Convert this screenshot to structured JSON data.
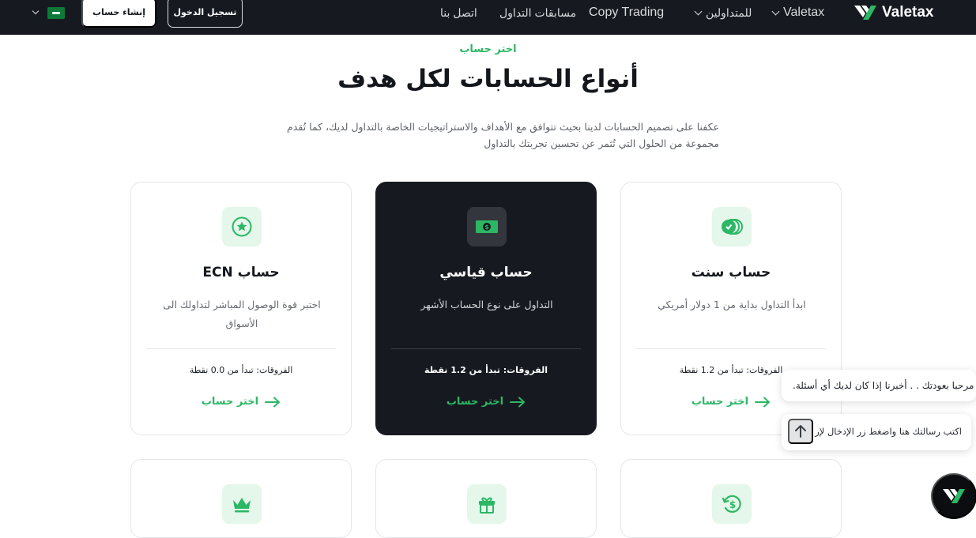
{
  "nav": {
    "brand": "Valetax",
    "items": {
      "valetax": "Valetax",
      "traders": "للمتداولين",
      "copy_trading": "Copy Trading",
      "competitions": "مسابقات التداول",
      "contact": "اتصل بنا"
    },
    "login_label": "تسجيل الدخول",
    "register_label": "إنشاء حساب",
    "language_flag": "saudi-arabia-flag"
  },
  "hero": {
    "eyebrow": "اختر حساب",
    "title": "أنواع الحسابات لكل هدف",
    "description": "عكفنا على تصميم الحسابات لدينا بحيث تتوافق مع الأهداف والاستراتيجيات الخاصة بالتداول لديك، كما تُقدم مجموعة من الحلول التي تُثمر عن تحسين تجربتك بالتداول"
  },
  "accounts": [
    {
      "title": "حساب سنت",
      "subtitle": "ابدأ التداول بداية من 1 دولار أمريكي",
      "spread": "الفروقات: تبدأ من 1.2 نقطة",
      "cta": "اختر حساب",
      "icon": "coins-icon",
      "highlighted": false
    },
    {
      "title": "حساب قياسي",
      "subtitle": "التداول على نوع الحساب الأشهر",
      "spread": "الفروقات: تبدأ من 1.2 نقطة",
      "cta": "اختر حساب",
      "icon": "banknote-icon",
      "highlighted": true
    },
    {
      "title": "حساب ECN",
      "subtitle": "اختبر قوة الوصول المباشر لتداولك الى الأسواق",
      "spread": "الفروقات: تبدأ من 0.0 نقطة",
      "cta": "اختر حساب",
      "icon": "star-icon",
      "highlighted": false
    }
  ],
  "accounts_row2_icons": [
    "dollar-refresh-icon",
    "gift-icon",
    "crown-icon"
  ],
  "chat": {
    "greeting": "مرحبا بعودتك . . أخبرنا إذا كان لديك أي أسئلة.",
    "input_placeholder": "اكتب رسالتك هنا واضغط زر الإدخال لإر"
  },
  "colors": {
    "nav_bg": "#161a20",
    "accent_green": "#2cb765",
    "icon_bg": "#e4f7ea",
    "dark_card": "#161a20"
  }
}
